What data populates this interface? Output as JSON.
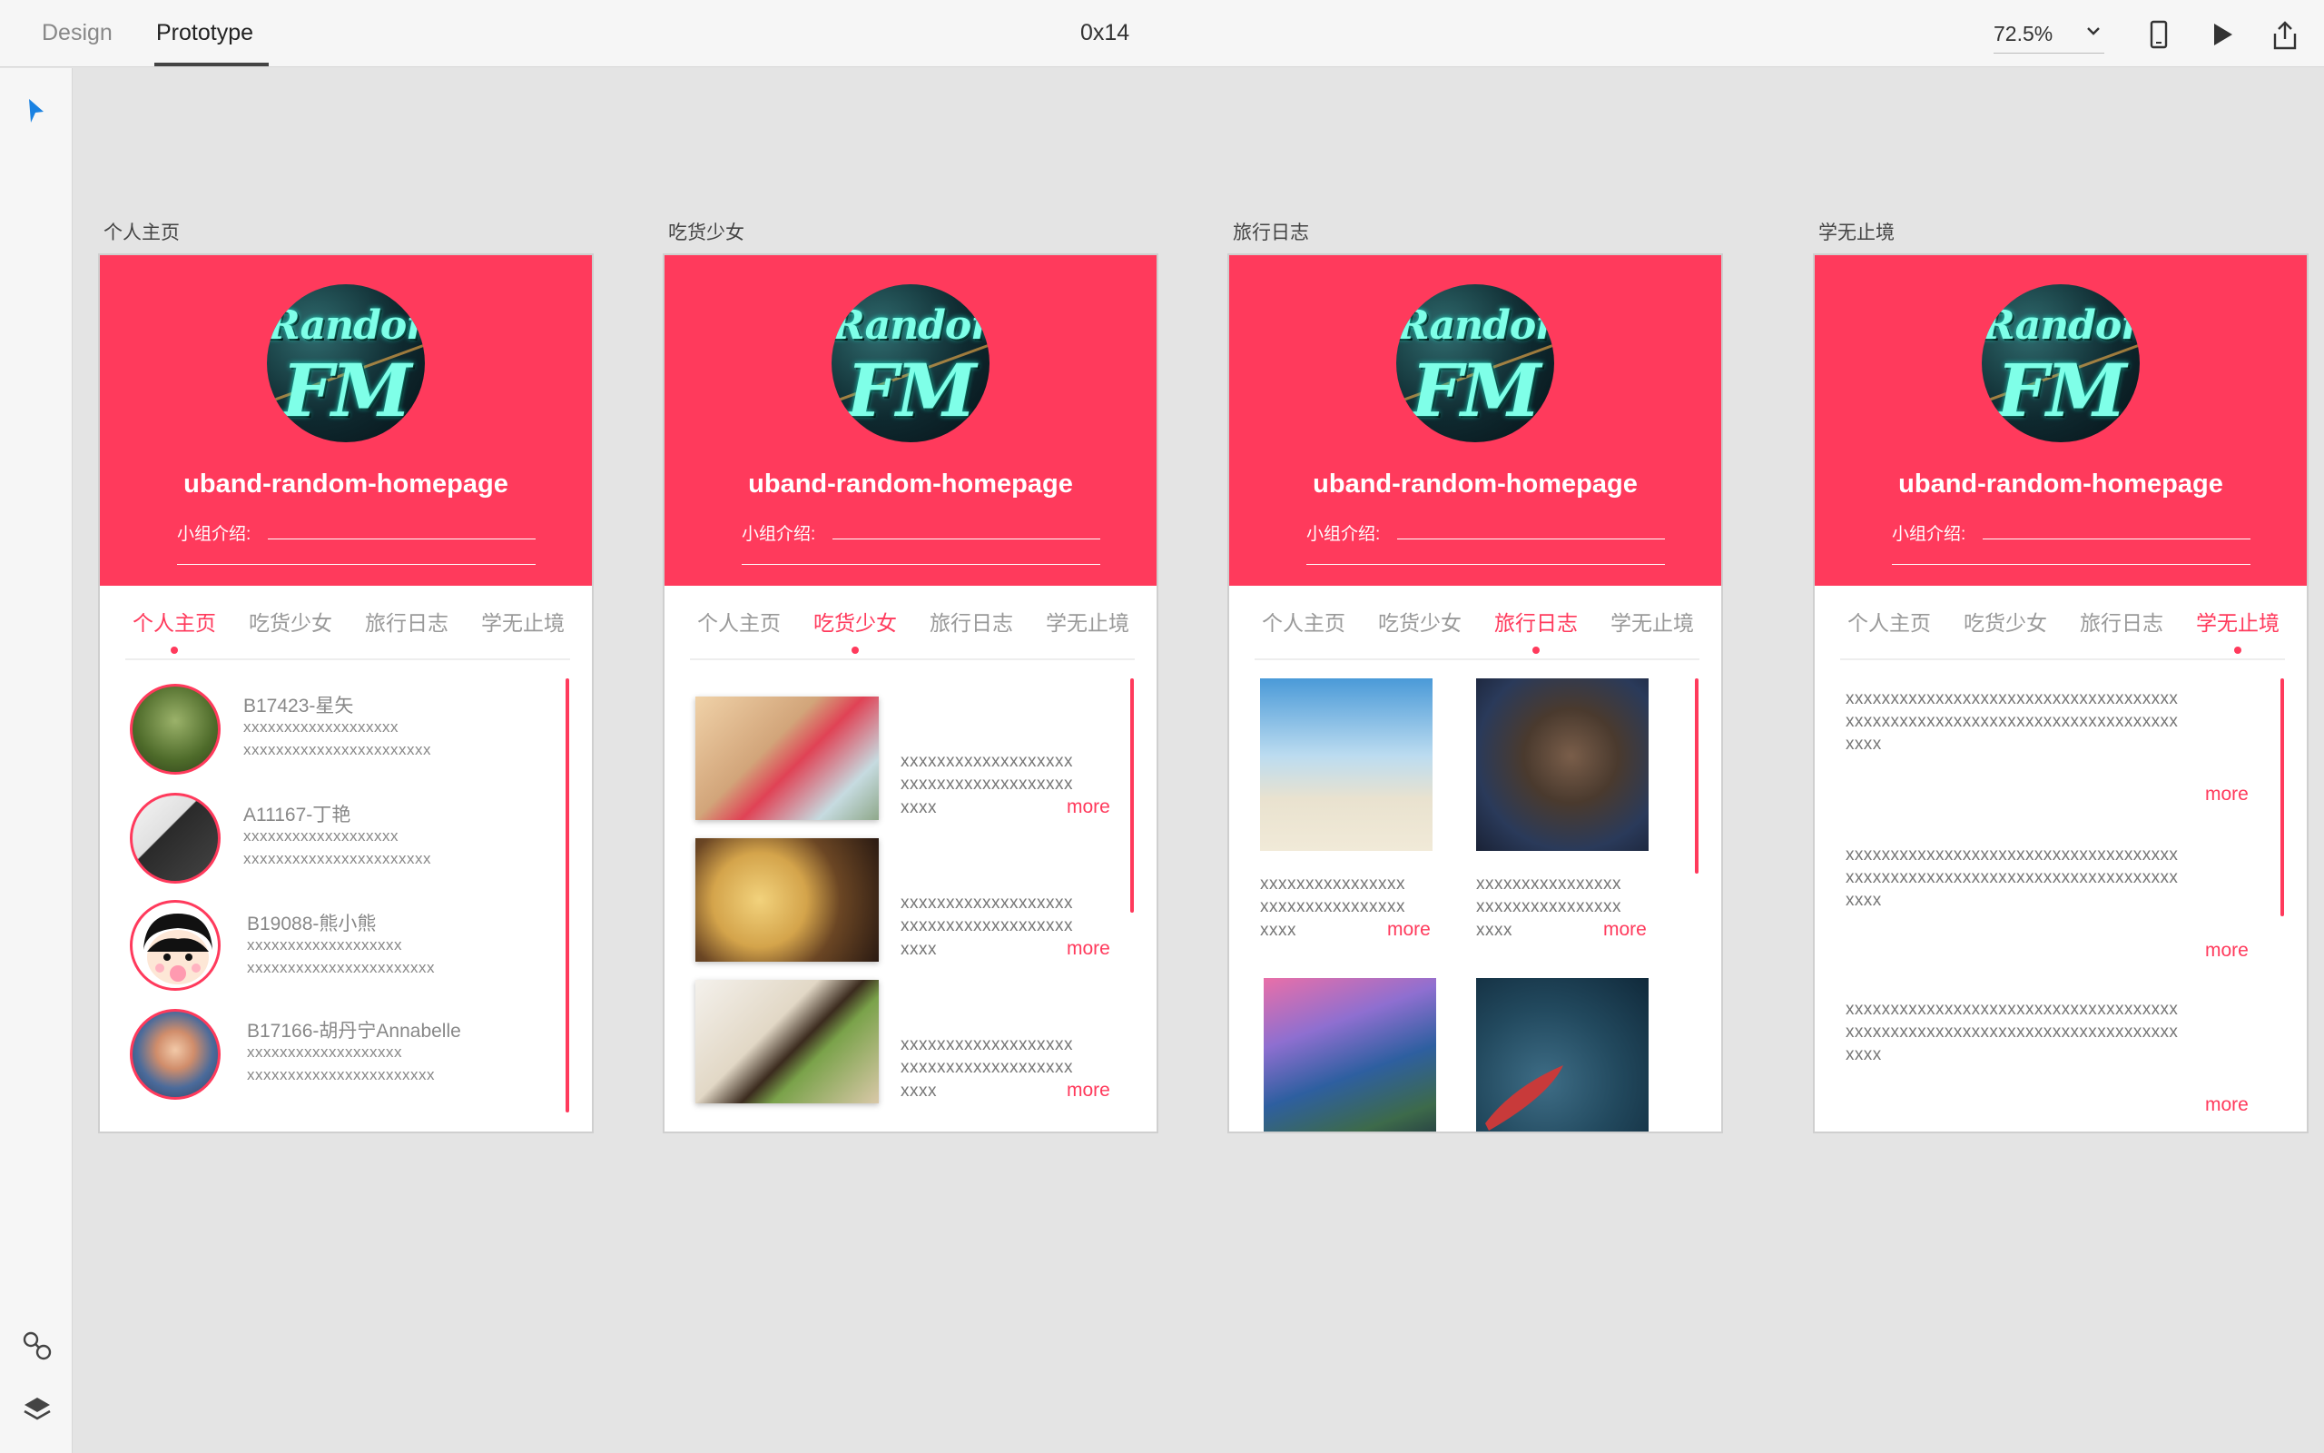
{
  "toolbar": {
    "tabs": [
      "Design",
      "Prototype"
    ],
    "document_title": "0x14",
    "zoom": "72.5%"
  },
  "icons": {
    "pointer": "cursor-arrow-icon",
    "link": "link-icon",
    "layers": "layers-icon",
    "device": "phone-icon",
    "play": "play-icon",
    "share": "share-icon"
  },
  "colors": {
    "accent": "#ff3a5c"
  },
  "artboards": [
    {
      "label": "个人主页",
      "active_tab": 0
    },
    {
      "label": "吃货少女",
      "active_tab": 1
    },
    {
      "label": "旅行日志",
      "active_tab": 2
    },
    {
      "label": "学无止境",
      "active_tab": 3
    }
  ],
  "hero": {
    "logo_line1": "Random",
    "logo_line2": "FM",
    "title": "uband-random-homepage",
    "intro_label": "小组介绍:"
  },
  "nav_tabs": [
    "个人主页",
    "吃货少女",
    "旅行日志",
    "学无止境"
  ],
  "members": [
    {
      "name": "B17423-星矢",
      "line1": "xxxxxxxxxxxxxxxxxxx",
      "line2": "xxxxxxxxxxxxxxxxxxxxxxx"
    },
    {
      "name": "A11167-丁艳",
      "line1": "xxxxxxxxxxxxxxxxxxx",
      "line2": "xxxxxxxxxxxxxxxxxxxxxxx"
    },
    {
      "name": "B19088-熊小熊",
      "line1": "xxxxxxxxxxxxxxxxxxx",
      "line2": "xxxxxxxxxxxxxxxxxxxxxxx"
    },
    {
      "name": "B17166-胡丹宁Annabelle",
      "line1": "xxxxxxxxxxxxxxxxxxx",
      "line2": "xxxxxxxxxxxxxxxxxxxxxxx"
    }
  ],
  "food_items": [
    {
      "line1": "xxxxxxxxxxxxxxxxxxx",
      "line2": "xxxxxxxxxxxxxxxxxxx",
      "line3": "xxxx",
      "more": "more"
    },
    {
      "line1": "xxxxxxxxxxxxxxxxxxx",
      "line2": "xxxxxxxxxxxxxxxxxxx",
      "line3": "xxxx",
      "more": "more"
    },
    {
      "line1": "xxxxxxxxxxxxxxxxxxx",
      "line2": "xxxxxxxxxxxxxxxxxxx",
      "line3": "xxxx",
      "more": "more"
    }
  ],
  "travel_items": [
    {
      "line1": "xxxxxxxxxxxxxxxx",
      "line2": "xxxxxxxxxxxxxxxx",
      "line3": "xxxx",
      "more": "more"
    },
    {
      "line1": "xxxxxxxxxxxxxxxx",
      "line2": "xxxxxxxxxxxxxxxx",
      "line3": "xxxx",
      "more": "more"
    }
  ],
  "study_items": [
    {
      "line1": "xxxxxxxxxxxxxxxxxxxxxxxxxxxxxxxxxxxxx",
      "line2": "xxxxxxxxxxxxxxxxxxxxxxxxxxxxxxxxxxxxx",
      "line3": "xxxx",
      "more": "more"
    },
    {
      "line1": "xxxxxxxxxxxxxxxxxxxxxxxxxxxxxxxxxxxxx",
      "line2": "xxxxxxxxxxxxxxxxxxxxxxxxxxxxxxxxxxxxx",
      "line3": "xxxx",
      "more": "more"
    },
    {
      "line1": "xxxxxxxxxxxxxxxxxxxxxxxxxxxxxxxxxxxxx",
      "line2": "xxxxxxxxxxxxxxxxxxxxxxxxxxxxxxxxxxxxx",
      "line3": "xxxx",
      "more": "more"
    }
  ]
}
